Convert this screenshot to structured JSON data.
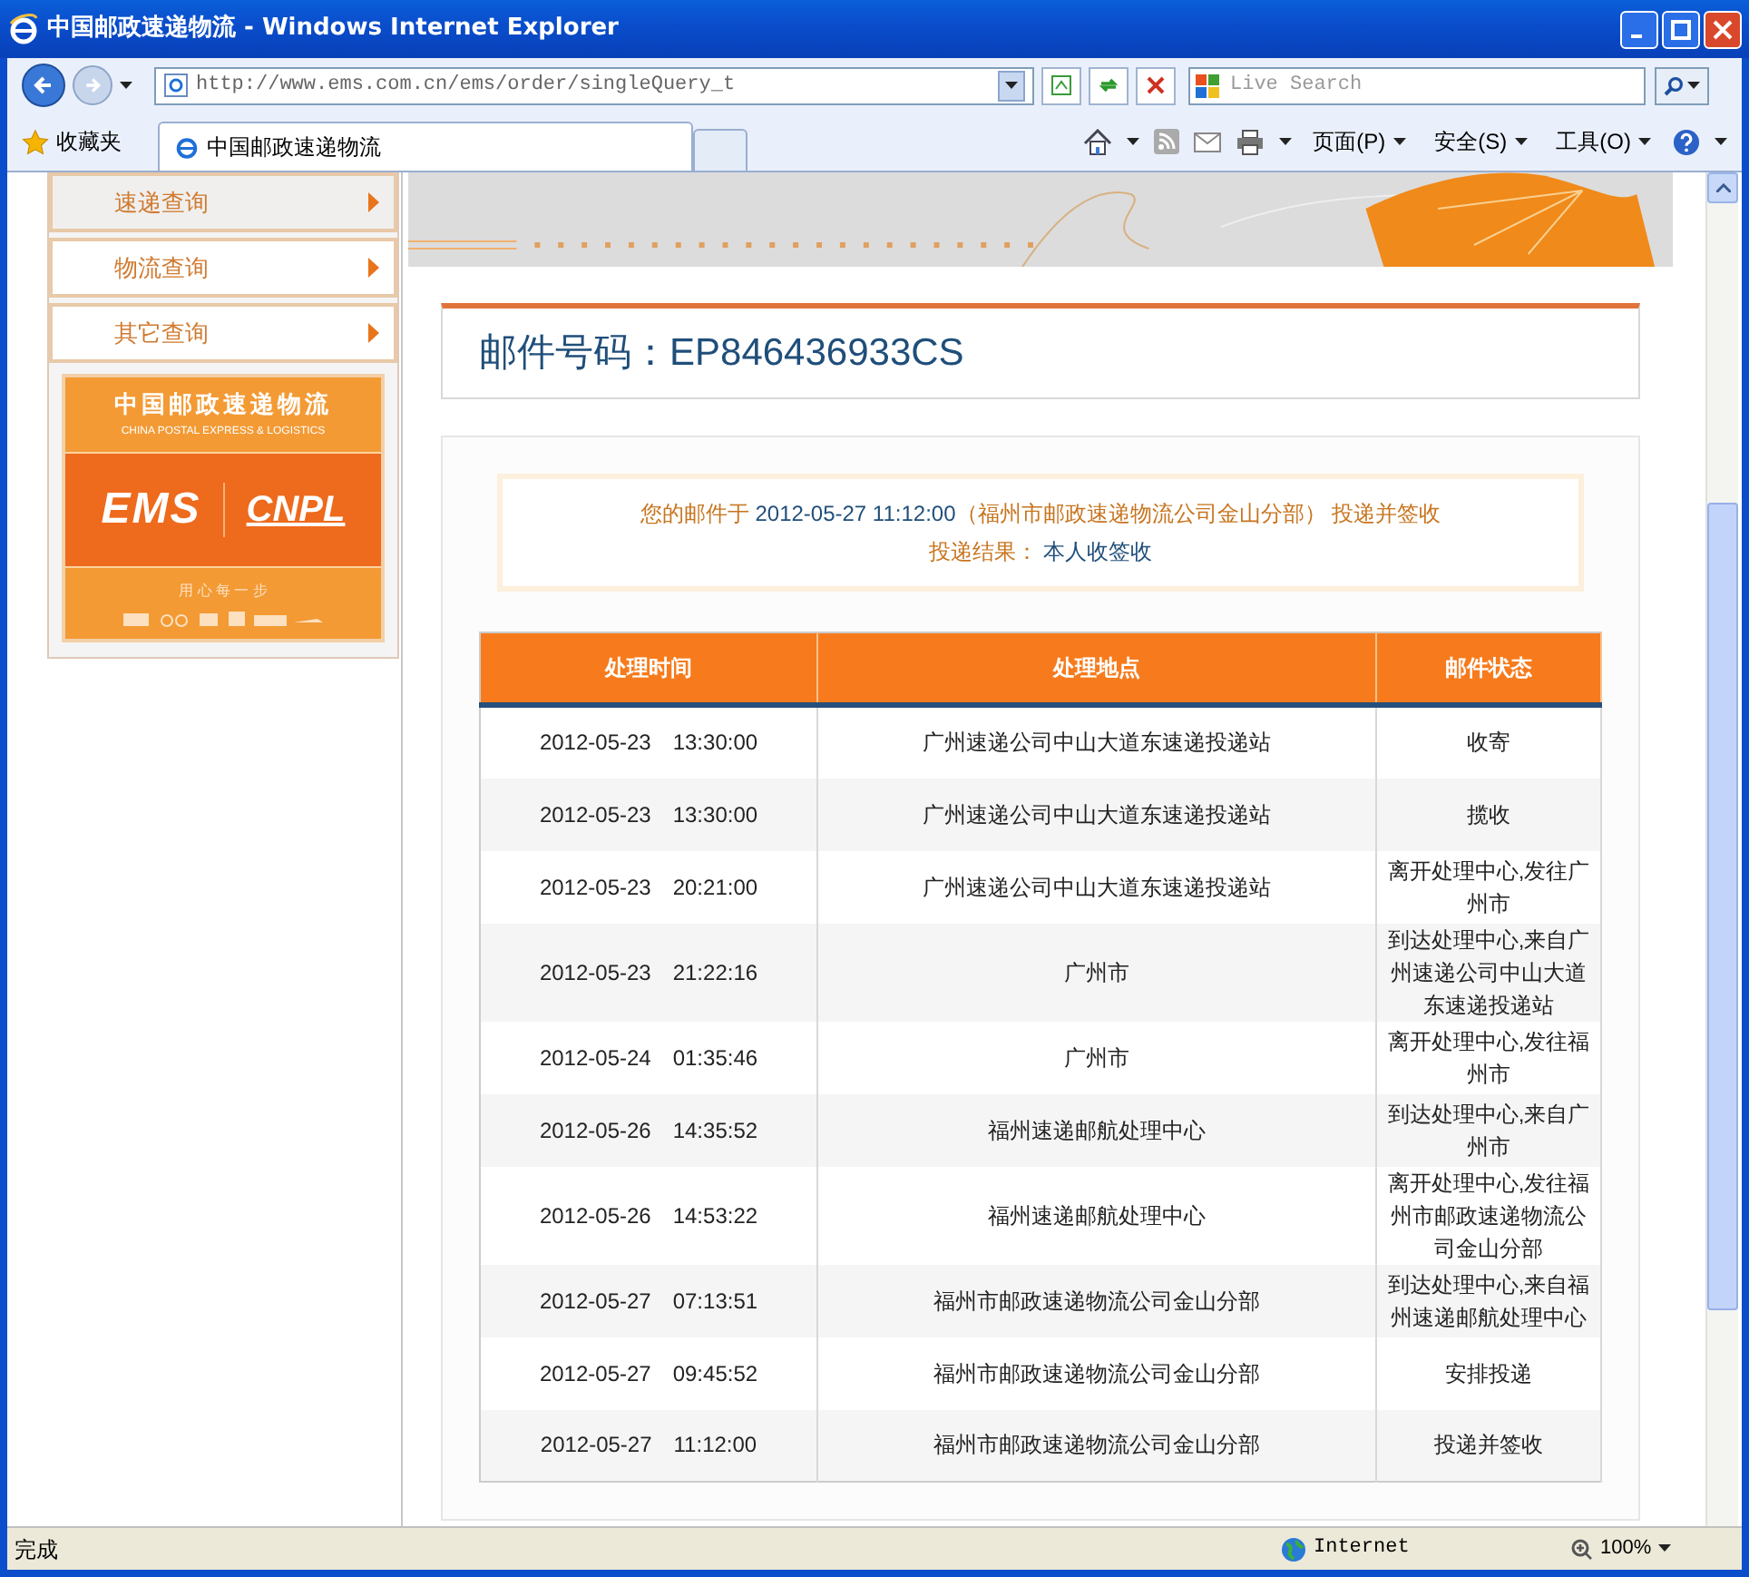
{
  "window": {
    "title": "中国邮政速递物流 - Windows Internet Explorer"
  },
  "address_bar": {
    "url": "http://www.ems.com.cn/ems/order/singleQuery_t",
    "search_placeholder": "Live Search"
  },
  "favorites": {
    "label": "收藏夹"
  },
  "tabs": [
    {
      "label": "中国邮政速递物流",
      "selected": true
    }
  ],
  "command_bar": [
    "页面(P)",
    "安全(S)",
    "工具(O)"
  ],
  "sidebar": {
    "items": [
      {
        "label": "速递查询",
        "selected": true
      },
      {
        "label": "物流查询",
        "selected": false
      },
      {
        "label": "其它查询",
        "selected": false
      }
    ],
    "logo": {
      "name_cn": "中国邮政速递物流",
      "name_en": "CHINA POSTAL EXPRESS & LOGISTICS",
      "brand_1": "EMS",
      "brand_2": "CNPL",
      "slogan": "用 心 每 一 步"
    }
  },
  "tracking": {
    "title": "邮件号码：EP846436933CS"
  },
  "summary": {
    "lines": [
      [
        {
          "text": "您的邮件于 ",
          "highlight": false
        },
        {
          "text": "2012-05-27 11:12:00",
          "highlight": true
        },
        {
          "text": "（福州市邮政速递物流公司金山分部） 投递并签收",
          "highlight": false
        }
      ],
      [
        {
          "text": "投递结果： ",
          "highlight": false
        },
        {
          "text": "本人收签收",
          "highlight": true
        }
      ]
    ]
  },
  "table": {
    "columns": [
      "处理时间",
      "处理地点",
      "邮件状态"
    ],
    "rows": [
      [
        "2012-05-23　13:30:00",
        "广州速递公司中山大道东速递投递站",
        "收寄"
      ],
      [
        "2012-05-23　13:30:00",
        "广州速递公司中山大道东速递投递站",
        "揽收"
      ],
      [
        "2012-05-23　20:21:00",
        "广州速递公司中山大道东速递投递站",
        "离开处理中心,发往广州市"
      ],
      [
        "2012-05-23　21:22:16",
        "广州市",
        "到达处理中心,来自广州速递公司中山大道东速递投递站"
      ],
      [
        "2012-05-24　01:35:46",
        "广州市",
        "离开处理中心,发往福州市"
      ],
      [
        "2012-05-26　14:35:52",
        "福州速递邮航处理中心",
        "到达处理中心,来自广州市"
      ],
      [
        "2012-05-26　14:53:22",
        "福州速递邮航处理中心",
        "离开处理中心,发往福州市邮政速递物流公司金山分部"
      ],
      [
        "2012-05-27　07:13:51",
        "福州市邮政速递物流公司金山分部",
        "到达处理中心,来自福州速递邮航处理中心"
      ],
      [
        "2012-05-27　09:45:52",
        "福州市邮政速递物流公司金山分部",
        "安排投递"
      ],
      [
        "2012-05-27　11:12:00",
        "福州市邮政速递物流公司金山分部",
        "投递并签收"
      ]
    ]
  },
  "status_bar": {
    "text": "完成",
    "zone": "Internet",
    "zoom": "100%"
  }
}
